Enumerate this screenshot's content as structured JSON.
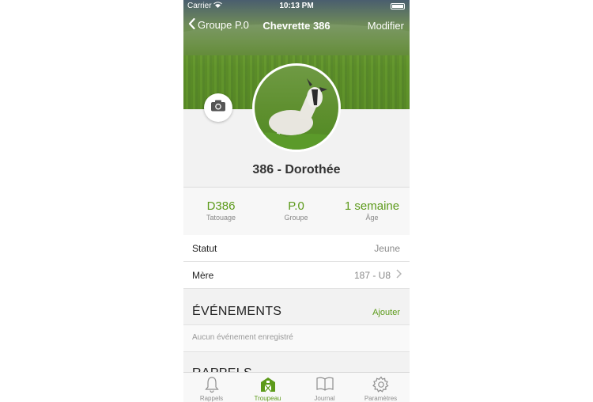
{
  "status_bar": {
    "carrier": "Carrier",
    "time": "10:13 PM"
  },
  "nav": {
    "back_label": "Groupe P.0",
    "title": "Chevrette 386",
    "edit_label": "Modifier"
  },
  "profile": {
    "name": "386 - Dorothée"
  },
  "stats": [
    {
      "value": "D386",
      "label": "Tatouage"
    },
    {
      "value": "P.0",
      "label": "Groupe"
    },
    {
      "value": "1 semaine",
      "label": "Âge"
    }
  ],
  "details": [
    {
      "key": "Statut",
      "value": "Jeune"
    },
    {
      "key": "Mère",
      "value": "187 - U8"
    }
  ],
  "events": {
    "title": "ÉVÉNEMENTS",
    "action": "Ajouter",
    "empty": "Aucun événement enregistré"
  },
  "reminders": {
    "title": "RAPPELS"
  },
  "tabs": [
    {
      "label": "Rappels",
      "icon": "bell-icon"
    },
    {
      "label": "Troupeau",
      "icon": "barn-icon"
    },
    {
      "label": "Journal",
      "icon": "book-icon"
    },
    {
      "label": "Paramètres",
      "icon": "gear-icon"
    }
  ],
  "colors": {
    "accent": "#5c9a1a",
    "tab_active": "#5c9a1a"
  }
}
